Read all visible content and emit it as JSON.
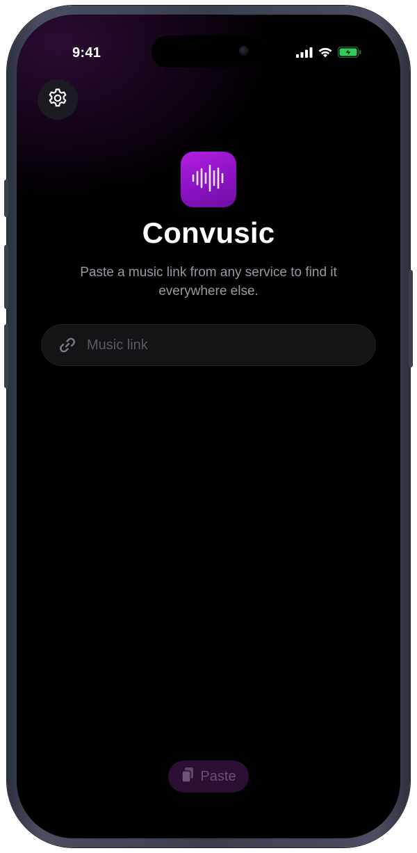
{
  "status_bar": {
    "time": "9:41",
    "icons": [
      "cellular-signal-icon",
      "wifi-icon",
      "battery-charging-icon"
    ]
  },
  "toolbar": {
    "settings_icon": "gear-icon"
  },
  "header": {
    "app_icon": "waveform-icon",
    "title": "Convusic",
    "subtitle": "Paste a music link from any service to find it everywhere else."
  },
  "link_field": {
    "icon": "link-icon",
    "value": "",
    "placeholder": "Music link"
  },
  "paste_button": {
    "icon": "clipboard-icon",
    "label": "Paste"
  },
  "colors": {
    "accent": "#9b19d6",
    "background": "#000000",
    "battery": "#34c759"
  }
}
